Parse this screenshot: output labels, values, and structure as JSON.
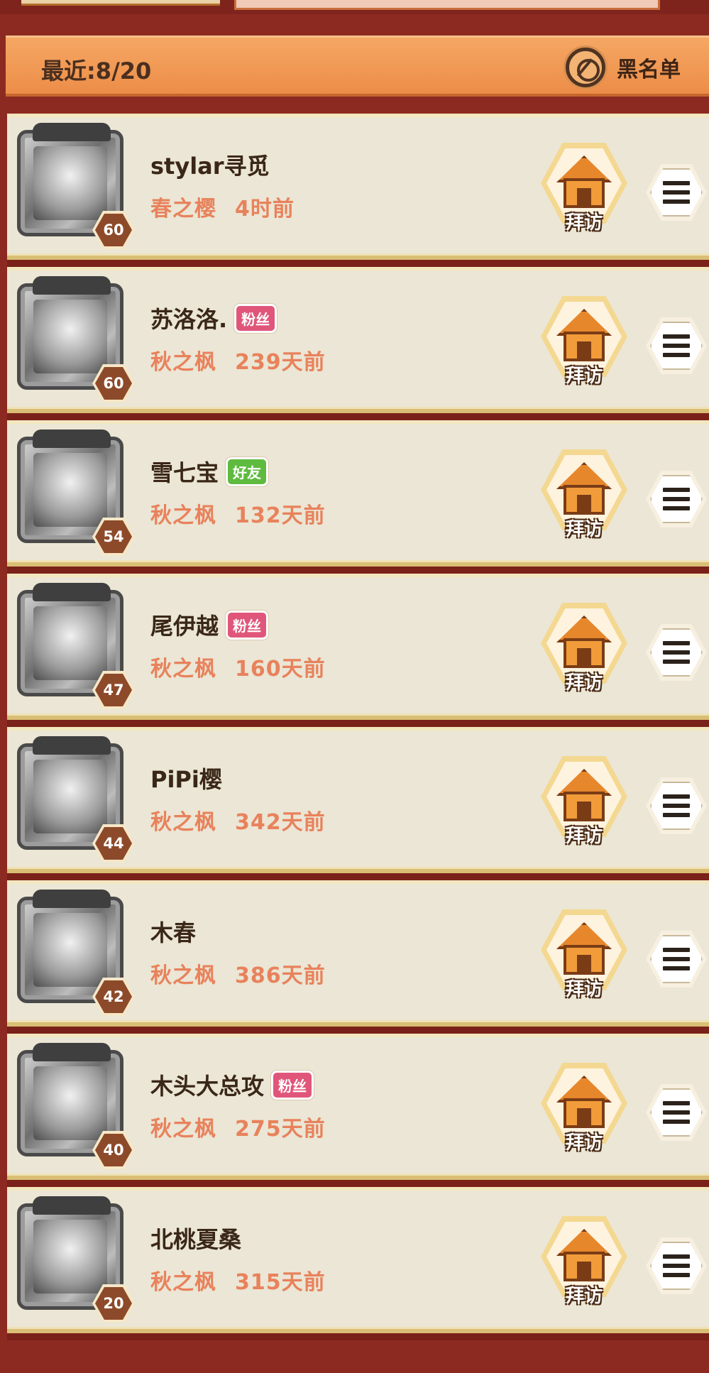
{
  "header": {
    "recent_label": "最近:8/20",
    "blacklist_label": "黑名单"
  },
  "entries": [
    {
      "name": "stylar寻觅",
      "tag": "",
      "tag_type": "",
      "server": "春之樱",
      "time": "4时前",
      "level": "60"
    },
    {
      "name": "苏洛洛.",
      "tag": "粉丝",
      "tag_type": "fan",
      "server": "秋之枫",
      "time": "239天前",
      "level": "60"
    },
    {
      "name": "雪七宝",
      "tag": "好友",
      "tag_type": "friend",
      "server": "秋之枫",
      "time": "132天前",
      "level": "54"
    },
    {
      "name": "尾伊越",
      "tag": "粉丝",
      "tag_type": "fan",
      "server": "秋之枫",
      "time": "160天前",
      "level": "47"
    },
    {
      "name": "PiPi樱",
      "tag": "",
      "tag_type": "",
      "server": "秋之枫",
      "time": "342天前",
      "level": "44"
    },
    {
      "name": "木春",
      "tag": "",
      "tag_type": "",
      "server": "秋之枫",
      "time": "386天前",
      "level": "42"
    },
    {
      "name": "木头大总攻",
      "tag": "粉丝",
      "tag_type": "fan",
      "server": "秋之枫",
      "time": "275天前",
      "level": "40"
    },
    {
      "name": "北桃夏桑",
      "tag": "",
      "tag_type": "",
      "server": "秋之枫",
      "time": "315天前",
      "level": "20"
    }
  ],
  "visit_label": "拜访",
  "colors": {
    "fan_tag": "#e0567a",
    "friend_tag": "#5fbb3f",
    "subtext": "#e8825c",
    "header_bg": "#ec8d48"
  }
}
